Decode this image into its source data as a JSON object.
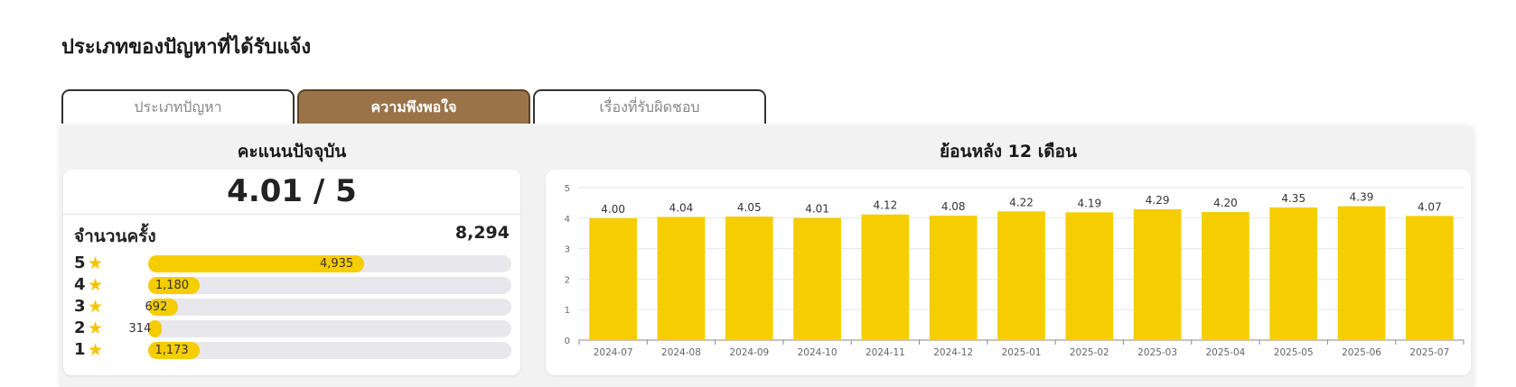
{
  "page": {
    "title": "ประเภทของปัญหาที่ได้รับแจ้ง",
    "tabs": [
      {
        "label": "ประเภทปัญหา",
        "active": false
      },
      {
        "label": "ความพึงพอใจ",
        "active": true
      },
      {
        "label": "เรื่องที่รับผิดชอบ",
        "active": false
      }
    ]
  },
  "current": {
    "title": "คะแนนปัจจุบัน",
    "score": "4.01 / 5",
    "count_label": "จำนวนครั้ง",
    "count_value": "8,294",
    "ratings": [
      {
        "stars": "5",
        "count": "4,935",
        "fraction": 0.595
      },
      {
        "stars": "4",
        "count": "1,180",
        "fraction": 0.142
      },
      {
        "stars": "3",
        "count": "692",
        "fraction": 0.083
      },
      {
        "stars": "2",
        "count": "314",
        "fraction": 0.038
      },
      {
        "stars": "1",
        "count": "1,173",
        "fraction": 0.141
      }
    ],
    "bar_color": "#f5cd00",
    "star_color": "#f5c400"
  },
  "history": {
    "title": "ย้อนหลัง 12 เดือน"
  },
  "chart_data": {
    "type": "bar",
    "categories": [
      "2024-07",
      "2024-08",
      "2024-09",
      "2024-10",
      "2024-11",
      "2024-12",
      "2025-01",
      "2025-02",
      "2025-03",
      "2025-04",
      "2025-05",
      "2025-06",
      "2025-07"
    ],
    "values": [
      4.0,
      4.04,
      4.05,
      4.01,
      4.12,
      4.08,
      4.22,
      4.19,
      4.29,
      4.2,
      4.35,
      4.39,
      4.07
    ],
    "value_labels": [
      "4.00",
      "4.04",
      "4.05",
      "4.01",
      "4.12",
      "4.08",
      "4.22",
      "4.19",
      "4.29",
      "4.20",
      "4.35",
      "4.39",
      "4.07"
    ],
    "ylim": [
      0,
      5
    ],
    "yticks": [
      0,
      1,
      2,
      3,
      4,
      5
    ],
    "grid": true,
    "bar_color": "#f5cd00",
    "title": "",
    "xlabel": "",
    "ylabel": ""
  }
}
